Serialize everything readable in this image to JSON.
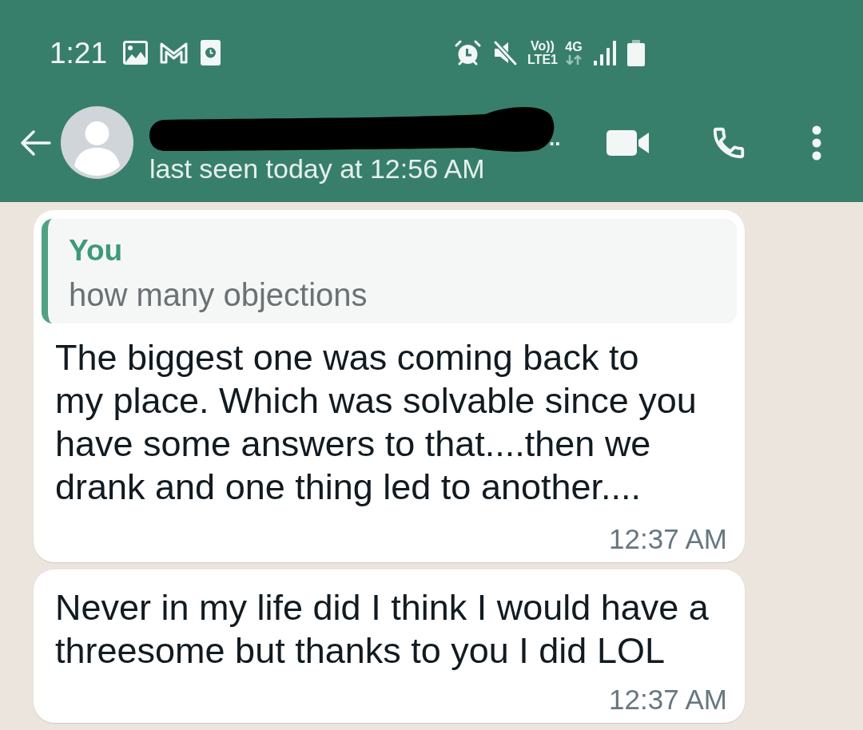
{
  "status_bar": {
    "time": "1:21",
    "volte_label": "Vo))",
    "network_label": "LTE1",
    "data_type": "4G"
  },
  "header": {
    "name_visible": "..",
    "last_seen": "last seen today at 12:56 AM"
  },
  "messages": [
    {
      "quote": {
        "author": "You",
        "text": "how many objections"
      },
      "lines": [
        "The biggest one was coming back to",
        "my place. Which was solvable since you",
        "have some answers to that....then we",
        "drank and one thing led to another...."
      ],
      "time": "12:37 AM"
    },
    {
      "lines": [
        "Never in my life did I think I would have a",
        "threesome but thanks to you I did LOL"
      ],
      "time": "12:37 AM"
    }
  ]
}
